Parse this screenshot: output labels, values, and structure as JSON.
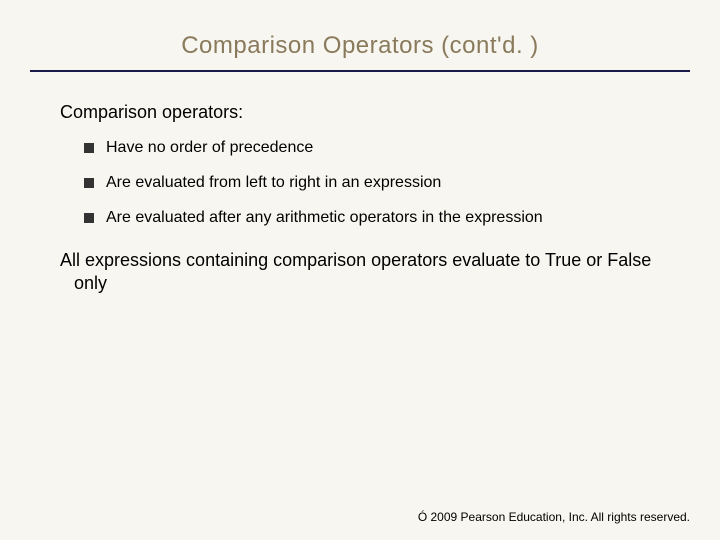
{
  "title": "Comparison Operators (cont'd. )",
  "content": {
    "intro": "Comparison operators:",
    "bullets": [
      "Have no order of precedence",
      "Are evaluated from left to right in an expression",
      "Are evaluated after any arithmetic operators in the expression"
    ],
    "closing": "All expressions containing comparison operators evaluate to True or False only"
  },
  "footer": "Ó 2009 Pearson Education, Inc.  All rights reserved."
}
